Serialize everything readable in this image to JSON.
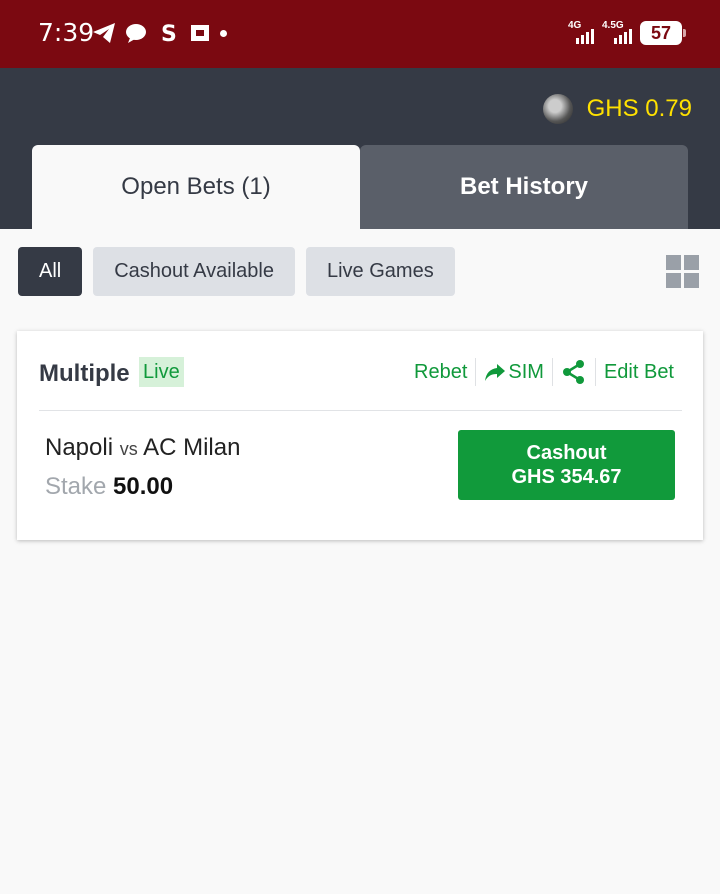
{
  "status_bar": {
    "time": "7:39",
    "network_1": "4G",
    "network_2": "4.5G",
    "battery": "57"
  },
  "header": {
    "balance": "GHS 0.79",
    "tabs": [
      {
        "label": "Open Bets (1)",
        "active": true
      },
      {
        "label": "Bet History",
        "active": false
      }
    ]
  },
  "filters": [
    {
      "label": "All",
      "active": true
    },
    {
      "label": "Cashout Available",
      "active": false
    },
    {
      "label": "Live Games",
      "active": false
    }
  ],
  "bet": {
    "type": "Multiple",
    "live_label": "Live",
    "actions": {
      "rebet": "Rebet",
      "sim": "SIM",
      "edit": "Edit Bet"
    },
    "home": "Napoli",
    "vs": "vs",
    "away": "AC Milan",
    "stake_label": "Stake",
    "stake_value": "50.00",
    "cashout_label": "Cashout",
    "cashout_amount": "GHS 354.67"
  },
  "colors": {
    "status_bar": "#7b0911",
    "header": "#353a45",
    "accent_green": "#119a3b",
    "balance_yellow": "#ffe100"
  }
}
